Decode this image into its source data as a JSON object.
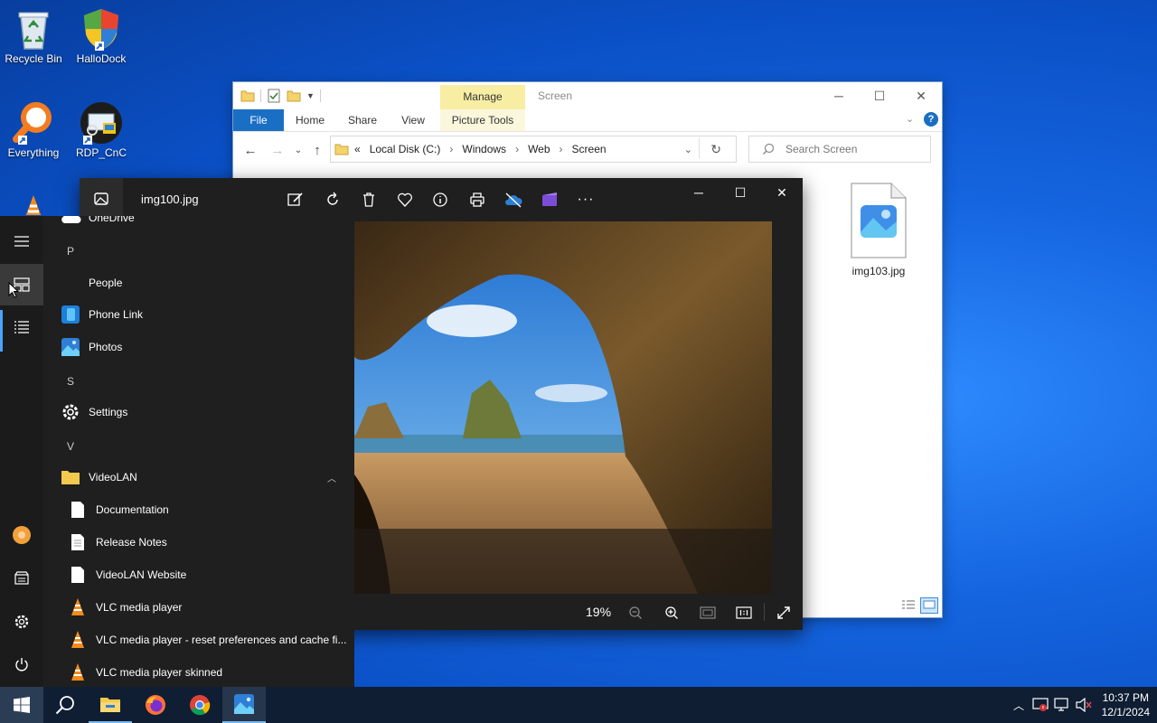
{
  "desktop": {
    "icons": [
      {
        "label": "Recycle Bin"
      },
      {
        "label": "HalloDock"
      },
      {
        "label": "Everything"
      },
      {
        "label": "RDP_CnC"
      }
    ]
  },
  "explorer": {
    "manage_tab": "Manage",
    "title": "Screen",
    "ribbon_tabs": [
      "File",
      "Home",
      "Share",
      "View",
      "Picture Tools"
    ],
    "breadcrumb": [
      "«",
      "Local Disk (C:)",
      "›",
      "Windows",
      "›",
      "Web",
      "›",
      "Screen"
    ],
    "search_placeholder": "Search Screen",
    "files": [
      {
        "name": "img103.jpg"
      }
    ]
  },
  "photos": {
    "file_name": "img100.jpg",
    "zoom": "19%"
  },
  "start_menu": {
    "items": [
      {
        "type": "app",
        "label": "OneDrive"
      },
      {
        "type": "letter",
        "label": "P"
      },
      {
        "type": "app",
        "label": "People"
      },
      {
        "type": "app",
        "label": "Phone Link"
      },
      {
        "type": "app",
        "label": "Photos"
      },
      {
        "type": "letter",
        "label": "S"
      },
      {
        "type": "app",
        "label": "Settings"
      },
      {
        "type": "letter",
        "label": "V"
      },
      {
        "type": "folder",
        "label": "VideoLAN"
      },
      {
        "type": "sub",
        "label": "Documentation"
      },
      {
        "type": "sub",
        "label": "Release Notes"
      },
      {
        "type": "sub",
        "label": "VideoLAN Website"
      },
      {
        "type": "sub",
        "label": "VLC media player"
      },
      {
        "type": "sub",
        "label": "VLC media player - reset preferences and cache fi..."
      },
      {
        "type": "sub",
        "label": "VLC media player skinned"
      }
    ]
  },
  "taskbar": {
    "time": "10:37 PM",
    "date": "12/1/2024"
  },
  "colors": {
    "explorer_file_tab": "#1a6fc4",
    "manage_tab": "#f7eea4",
    "taskbar": "#0f1e33",
    "start_bg": "#1f1f1f"
  }
}
